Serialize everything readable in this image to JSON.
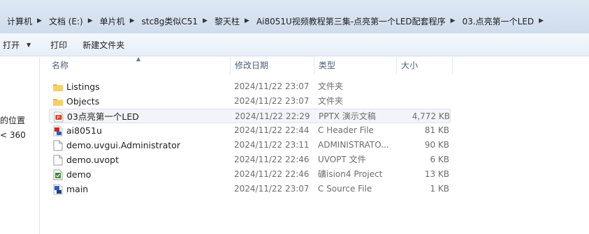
{
  "breadcrumb": [
    "计算机",
    "文档 (E:)",
    "单片机",
    "stc8g类似C51",
    "黎天柱",
    "Ai8051U视频教程第三集-点亮第一个LED配套程序",
    "03.点亮第一个LED"
  ],
  "toolbar": {
    "open_label": "打开",
    "print_label": "打印",
    "new_folder_label": "新建文件夹"
  },
  "navpane": {
    "item_1": "的位置",
    "item_2": "< 360"
  },
  "columns": {
    "name": "名称",
    "date": "修改日期",
    "type": "类型",
    "size": "大小"
  },
  "files": [
    {
      "name": "Listings",
      "date": "2024/11/22 23:07",
      "type": "文件夹",
      "size": "",
      "icon": "folder-icon"
    },
    {
      "name": "Objects",
      "date": "2024/11/22 23:07",
      "type": "文件夹",
      "size": "",
      "icon": "folder-icon"
    },
    {
      "name": "03点亮第一个LED",
      "date": "2024/11/22 22:29",
      "type": "PPTX 演示文稿",
      "size": "4,772 KB",
      "icon": "pptx-file-icon"
    },
    {
      "name": "ai8051u",
      "date": "2024/11/22 22:44",
      "type": "C Header File",
      "size": "81 KB",
      "icon": "c-header-file-icon"
    },
    {
      "name": "demo.uvgui.Administrator",
      "date": "2024/11/22 23:11",
      "type": "ADMINISTRATO...",
      "size": "90 KB",
      "icon": "generic-file-icon"
    },
    {
      "name": "demo.uvopt",
      "date": "2024/11/22 22:46",
      "type": "UVOPT 文件",
      "size": "6 KB",
      "icon": "generic-file-icon"
    },
    {
      "name": "demo",
      "date": "2024/11/22 22:46",
      "type": "礦ision4 Project",
      "size": "13 KB",
      "icon": "uvision-project-icon"
    },
    {
      "name": "main",
      "date": "2024/11/22 23:07",
      "type": "C Source File",
      "size": "1 KB",
      "icon": "c-source-file-icon"
    }
  ]
}
